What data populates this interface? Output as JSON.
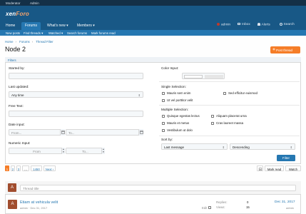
{
  "topbar": {
    "moderator": "Moderator",
    "admin": "Admin"
  },
  "brand": {
    "logo_main": "xen",
    "logo_accent": "Foro"
  },
  "nav": {
    "tabs": [
      "Home",
      "Forums",
      "What's new ▾",
      "Members ▾"
    ],
    "user": "admin",
    "inbox": "Inbox",
    "alerts": "Alerts",
    "search": "Search"
  },
  "subnav": [
    "New posts",
    "Find threads ▾",
    "Watched ▾",
    "Search forums",
    "Mark forums read"
  ],
  "breadcrumb": [
    "Home",
    "Forums",
    "Thread Filter"
  ],
  "page_title": "Node 2",
  "post_button": "Post thread",
  "filters": {
    "heading": "Filters",
    "started_by_label": "Started by:",
    "last_updated_label": "Last updated:",
    "last_updated_value": "Any time",
    "free_text_label": "Free Text:",
    "date_input_label": "Date input:",
    "date_from_placeholder": "From...",
    "date_to_placeholder": "To...",
    "numeric_input_label": "Numeric Input:",
    "num_from_placeholder": "From",
    "num_to_placeholder": "To...",
    "color_input_label": "Color Input:",
    "single_selection_label": "Single Selection:",
    "single_options": [
      "Mauris sem enim",
      "Sed efficitur euismod",
      "Ut vel porttitor velit"
    ],
    "multiple_selection_label": "Multiple Selection:",
    "multiple_options": [
      "Quisque egestas lectus",
      "Aliquam placerat urna",
      "Mauris et metus",
      "Cras laoreet massa",
      "Vestibulum ut dolo"
    ],
    "sort_label": "Sort by:",
    "sort_value": "Last message",
    "order_value": "Descending",
    "filter_button": "Filter"
  },
  "pagination": {
    "pages": [
      "1",
      "2",
      "3",
      "…",
      "1450"
    ],
    "next": "Next ›"
  },
  "tools": {
    "mark_read": "Mark read",
    "watch": "Watch"
  },
  "thread_list": {
    "new_thread_placeholder": "Thread title",
    "avatar_letter": "A",
    "thread": {
      "title": "Etiam at vehicula velit",
      "author": "admin",
      "date": "Dec 31, 2017",
      "meta": "admin · Dec 31, 2017",
      "edit": "Edit",
      "replies_label": "Replies:",
      "replies": "0",
      "views_label": "Views:",
      "views": "15",
      "last_date": "Dec 31, 2017",
      "last_user": "admin"
    }
  },
  "colors": {
    "header": "#185886",
    "accent": "#2577b1",
    "cta": "#f57d28",
    "topbar": "#143047"
  }
}
